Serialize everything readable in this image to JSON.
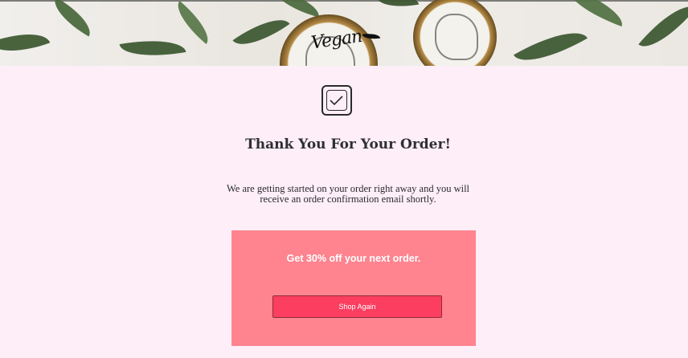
{
  "hero": {
    "logo_text": "Vegan"
  },
  "confirmation": {
    "icon": "check-box-icon",
    "title": "Thank You For Your Order!",
    "message": "We are getting started on your order right away and you will receive an order confirmation email shortly."
  },
  "promo": {
    "text": "Get 30% off your next order.",
    "button_label": "Shop Again",
    "background_color": "#ff8490",
    "button_color": "#fc3f60"
  },
  "colors": {
    "page_background": "#fdeef8",
    "text": "#2f2f33"
  }
}
